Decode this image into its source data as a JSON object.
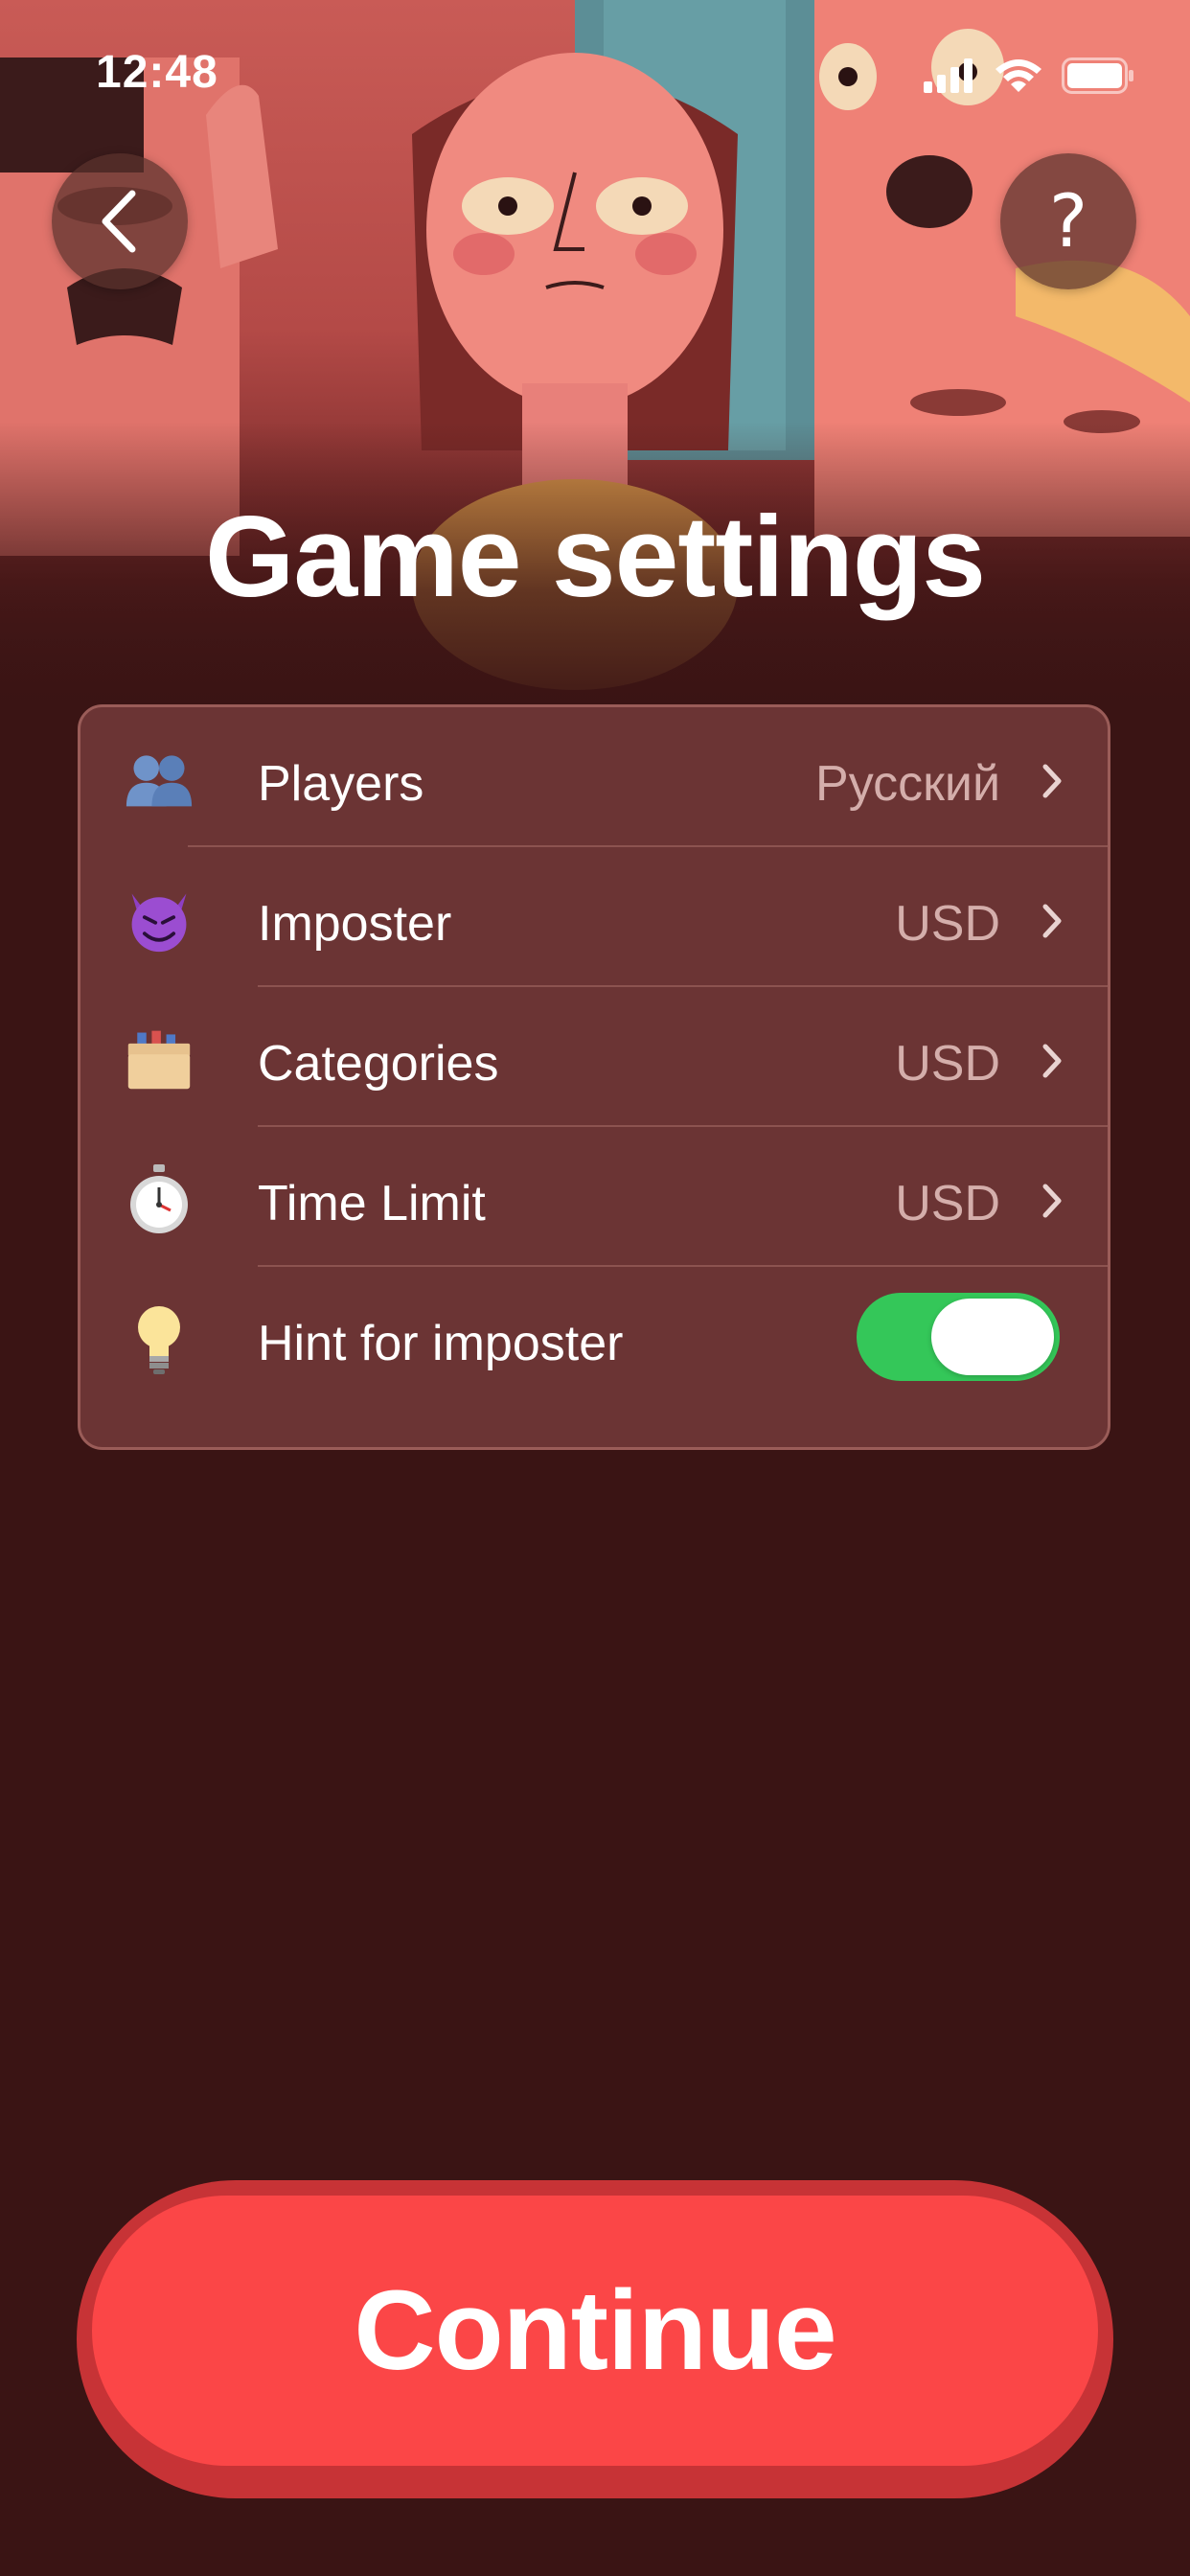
{
  "status_bar": {
    "time": "12:48"
  },
  "header": {
    "back_icon": "chevron-left-icon",
    "help_label": "?",
    "title": "Game settings"
  },
  "settings": [
    {
      "icon": "busts-silhouette-icon",
      "label": "Players",
      "value": "Русский",
      "type": "disclosure"
    },
    {
      "icon": "smiling-devil-icon",
      "label": "Imposter",
      "value": "USD",
      "type": "disclosure"
    },
    {
      "icon": "card-file-box-icon",
      "label": "Categories",
      "value": "USD",
      "type": "disclosure"
    },
    {
      "icon": "stopwatch-icon",
      "label": "Time Limit",
      "value": "USD",
      "type": "disclosure"
    },
    {
      "icon": "light-bulb-icon",
      "label": "Hint for imposter",
      "type": "toggle",
      "enabled": true
    }
  ],
  "footer": {
    "continue_label": "Continue"
  },
  "colors": {
    "background": "#3a1414",
    "card": "#6b3434",
    "accent": "#fb4647",
    "toggle_on": "#34c759"
  }
}
